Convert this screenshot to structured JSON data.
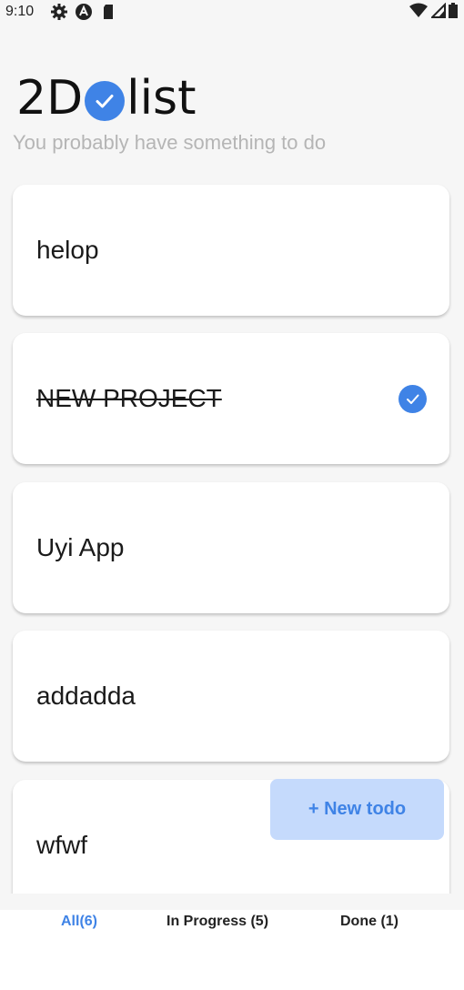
{
  "status_bar": {
    "time": "9:10",
    "icons": [
      "gear-icon",
      "a-icon",
      "sd-card-icon",
      "wifi-icon",
      "signal-icon",
      "battery-icon"
    ]
  },
  "header": {
    "logo_prefix": "2D",
    "logo_suffix": "list",
    "subtitle": "You probably have something to do"
  },
  "todos": [
    {
      "text": "helop",
      "done": false
    },
    {
      "text": "NEW PROJECT",
      "done": true
    },
    {
      "text": "Uyi App",
      "done": false
    },
    {
      "text": "addadda",
      "done": false
    },
    {
      "text": "wfwf",
      "done": false
    }
  ],
  "fab": {
    "label": "+ New todo"
  },
  "tabs": [
    {
      "label": "All(6)",
      "active": true
    },
    {
      "label": "In Progress (5)",
      "active": false
    },
    {
      "label": "Done (1)",
      "active": false
    }
  ],
  "colors": {
    "accent": "#3f83e6",
    "fab_background": "#c5dafc",
    "page_background": "#f6f6f6",
    "card_background": "#ffffff",
    "subtitle": "#b5b5b5"
  }
}
